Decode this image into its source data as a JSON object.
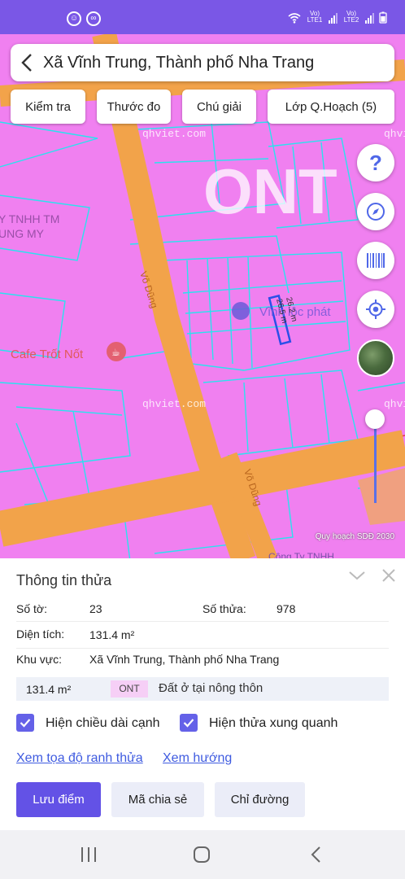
{
  "status": {
    "lte1": "Vo) LTE1",
    "lte2": "Vo) LTE2"
  },
  "header": {
    "title": "Xã Vĩnh Trung, Thành phố Nha Trang"
  },
  "toolbar": {
    "check": "Kiểm tra",
    "measure": "Thước đo",
    "legend": "Chú giải",
    "layers": "Lớp Q.Hoạch (5)"
  },
  "map": {
    "zone_code": "ONT",
    "watermark_top": "qhviet.com",
    "watermark_mid": "qhviet.com",
    "watermark_right_top": "qhviet",
    "watermark_right_mid": "qhviet",
    "poi_company_1": "Y TNHH TM",
    "poi_company_2": "UNG MY",
    "poi_cafe": "Cafe Trốt Nốt",
    "poi_place": "Vĩnh lộc phát",
    "road_1": "Võ Dũng",
    "road_2": "Võ Dũng",
    "poi_company_bottom": "Công Ty TNHH",
    "edge_label_1": "26.2 m",
    "edge_label_2": "26.5 m",
    "footnote": "Quy hoạch SDĐ 2030",
    "colors": {
      "residential": "#f080f0",
      "road": "#f2a34a",
      "boundary": "#29e3ee",
      "selected": "#2b4fe8"
    }
  },
  "parcel": {
    "title": "Thông tin thửa",
    "sheet_label": "Số tờ:",
    "sheet_value": "23",
    "plot_label": "Số thửa:",
    "plot_value": "978",
    "area_label": "Diện tích:",
    "area_value": "131.4 m²",
    "region_label": "Khu vực:",
    "region_value": "Xã Vĩnh Trung, Thành phố Nha Trang",
    "land_area": "131.4 m²",
    "land_code": "ONT",
    "land_desc": "Đất ở tại nông thôn",
    "show_edges_label": "Hiện chiều dài cạnh",
    "show_neighbors_label": "Hiện thửa xung quanh",
    "show_edges_checked": true,
    "show_neighbors_checked": true,
    "link_coords": "Xem tọa độ ranh thửa",
    "link_direction": "Xem hướng",
    "btn_save": "Lưu điểm",
    "btn_share": "Mã chia sẻ",
    "btn_route": "Chỉ đường"
  }
}
